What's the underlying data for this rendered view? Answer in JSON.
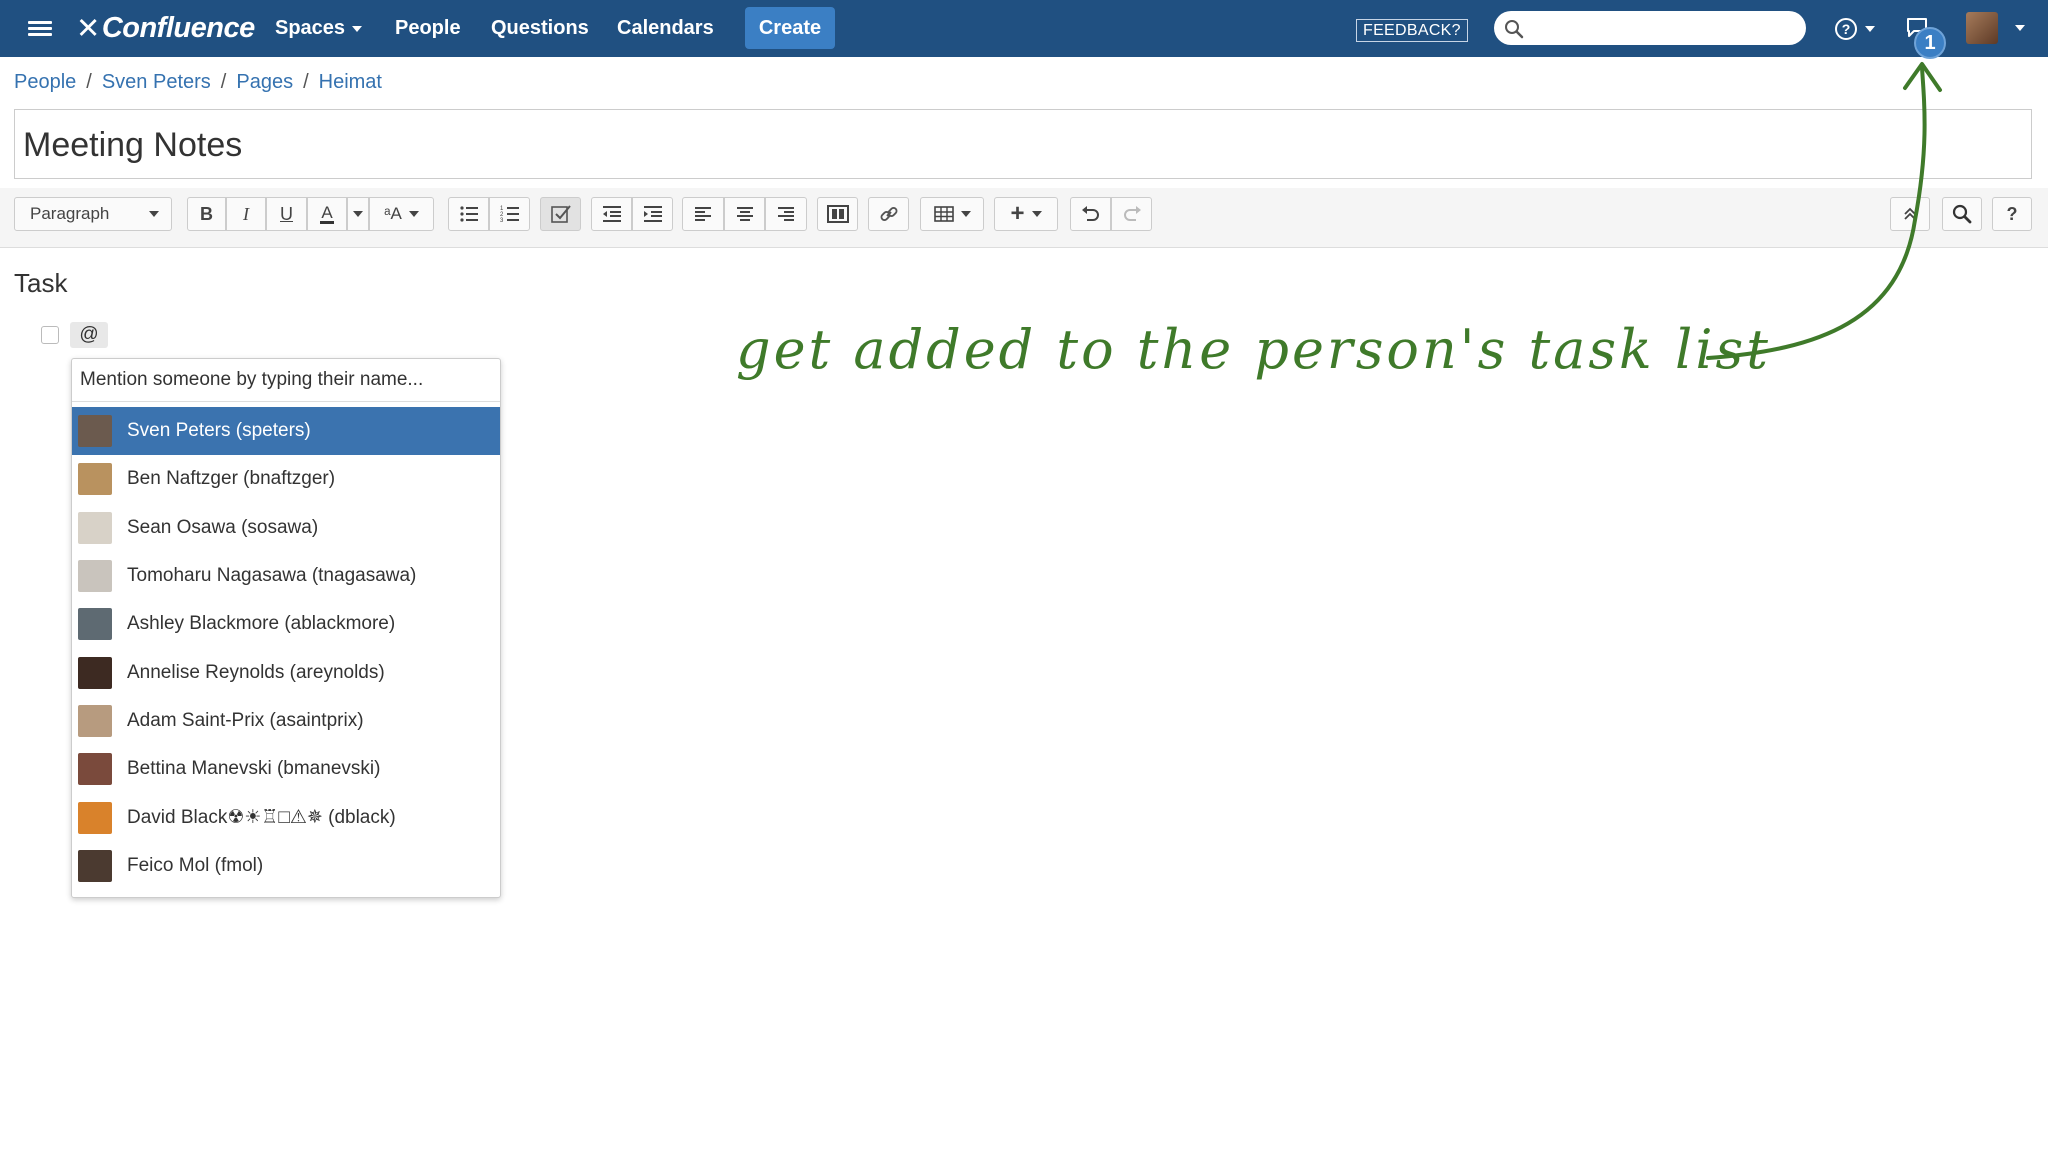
{
  "nav": {
    "logo": "Confluence",
    "items": [
      {
        "label": "Spaces",
        "has_caret": true
      },
      {
        "label": "People",
        "has_caret": false
      },
      {
        "label": "Questions",
        "has_caret": false
      },
      {
        "label": "Calendars",
        "has_caret": false
      }
    ],
    "create_label": "Create",
    "feedback_label": "FEEDBACK?",
    "search_placeholder": "",
    "notification_count": "1",
    "icons": [
      "menu-icon",
      "search-icon",
      "help-icon",
      "notification-icon",
      "user-avatar"
    ],
    "colors": {
      "bar": "#205081",
      "create": "#3b7fc4"
    }
  },
  "breadcrumbs": [
    "People",
    "Sven Peters",
    "Pages",
    "Heimat"
  ],
  "page": {
    "title": "Meeting Notes"
  },
  "toolbar": {
    "paragraph_label": "Paragraph",
    "icons": [
      "bold-icon",
      "italic-icon",
      "underline-icon",
      "text-color-icon",
      "more-formatting-icon",
      "bullet-list-icon",
      "numbered-list-icon",
      "task-list-icon",
      "outdent-icon",
      "indent-icon",
      "align-left-icon",
      "align-center-icon",
      "align-right-icon",
      "page-layout-icon",
      "link-icon",
      "table-icon",
      "insert-icon",
      "undo-icon",
      "redo-icon",
      "collapse-icon",
      "find-icon",
      "help-icon"
    ]
  },
  "content": {
    "heading": "Task",
    "mention_trigger": "@"
  },
  "mention": {
    "hint": "Mention someone by typing their name...",
    "selected_index": 0,
    "users": [
      {
        "name": "Sven Peters (speters)",
        "avatar_color": "#6b5a4e"
      },
      {
        "name": "Ben Naftzger (bnaftzger)",
        "avatar_color": "#b9925f"
      },
      {
        "name": "Sean Osawa (sosawa)",
        "avatar_color": "#d8d2c8"
      },
      {
        "name": "Tomoharu Nagasawa (tnagasawa)",
        "avatar_color": "#c9c4bd"
      },
      {
        "name": "Ashley Blackmore (ablackmore)",
        "avatar_color": "#5e6a72"
      },
      {
        "name": "Annelise Reynolds (areynolds)",
        "avatar_color": "#3d2a22"
      },
      {
        "name": "Adam Saint-Prix (asaintprix)",
        "avatar_color": "#b79b7f"
      },
      {
        "name": "Bettina Manevski (bmanevski)",
        "avatar_color": "#7a4a3c"
      },
      {
        "name": "David Black☢☀♖□⚠✵ (dblack)",
        "avatar_color": "#d9822b"
      },
      {
        "name": "Feico Mol (fmol)",
        "avatar_color": "#4b3a30"
      }
    ]
  },
  "annotation": {
    "text": "get added to the person's task list",
    "color": "#3f7a2a"
  }
}
